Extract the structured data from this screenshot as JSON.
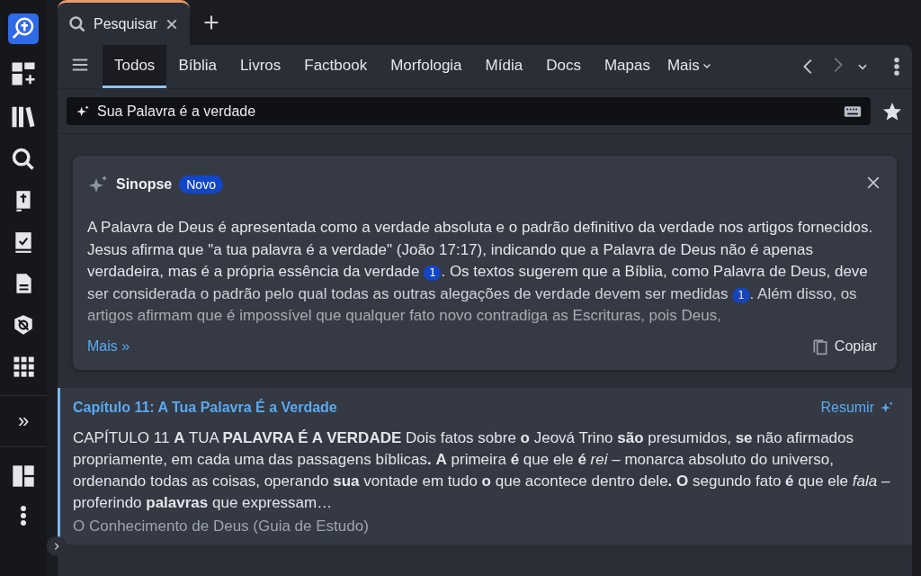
{
  "sidebar": {
    "expand": "»"
  },
  "tab": {
    "label": "Pesquisar",
    "selected": true
  },
  "nav": {
    "items": [
      {
        "label": "Todos",
        "selected": true
      },
      {
        "label": "Bíblia",
        "selected": false
      },
      {
        "label": "Livros",
        "selected": false
      },
      {
        "label": "Factbook",
        "selected": false
      },
      {
        "label": "Morfologia",
        "selected": false
      },
      {
        "label": "Mídia",
        "selected": false
      },
      {
        "label": "Docs",
        "selected": false
      },
      {
        "label": "Mapas",
        "selected": false
      }
    ],
    "more": "Mais"
  },
  "search": {
    "value": "Sua Palavra é a verdade"
  },
  "synopsis": {
    "title": "Sinopse",
    "badge": "Novo",
    "segments": [
      {
        "kind": "text",
        "text": "A Palavra de Deus é apresentada como a verdade absoluta e o padrão definitivo da verdade nos artigos fornecidos. Jesus afirma que \"a tua palavra é a verdade\" (João 17:17), indicando que a Palavra de Deus não é apenas verdadeira, mas é a própria essência da verdade "
      },
      {
        "kind": "cite",
        "text": "1"
      },
      {
        "kind": "text",
        "text": ". Os textos sugerem que a Bíblia, como Palavra de Deus, deve ser considerada o padrão pelo qual todas as outras alegações de verdade devem ser medidas "
      },
      {
        "kind": "cite",
        "text": "1"
      },
      {
        "kind": "text",
        "text": ". Além disso, os artigos afirmam que é impossível que qualquer fato novo contradiga as Escrituras, pois Deus,"
      }
    ],
    "more_link": "Mais »",
    "copy": "Copiar"
  },
  "results": [
    {
      "title": "Capítulo 11: A Tua Palavra É a Verdade",
      "action": "Resumir",
      "body": "CAPÍTULO 11 **A** TUA **PALAVRA É A VERDADE** Dois fatos sobre **o** Jeová Trino **são** presumidos, **se** não afirmados propriamente, em cada uma das passagens bíblicas**.** **A** primeira **é** que ele **é** *rei* – monarca absoluto do universo, ordenando todas as coisas, operando **sua** vontade em tudo **o** que acontece dentro dele**.** **O** segundo fato **é** que ele *fala* – proferindo **palavras** que expressam…",
      "source": "O Conhecimento de Deus (Guia de Estudo)"
    }
  ]
}
